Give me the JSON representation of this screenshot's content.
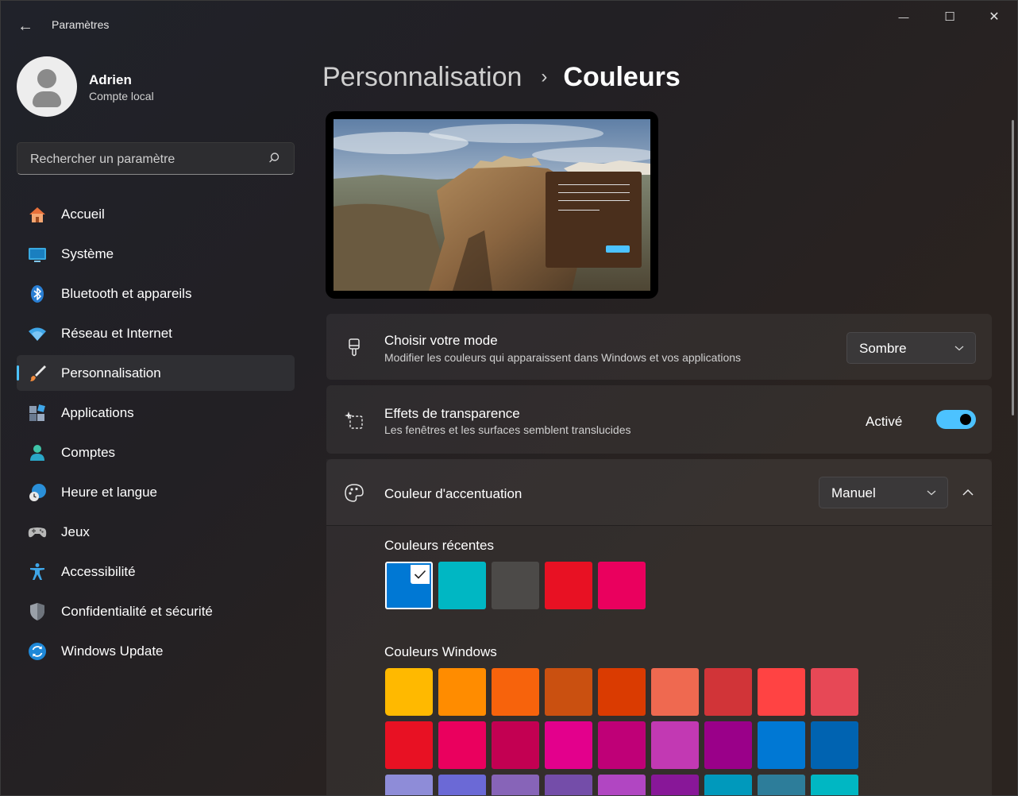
{
  "window": {
    "title": "Paramètres",
    "back_glyph": "←",
    "minimize_glyph": "—",
    "maximize_glyph": "☐",
    "close_glyph": "✕"
  },
  "profile": {
    "name": "Adrien",
    "account_type": "Compte local"
  },
  "search": {
    "placeholder": "Rechercher un paramètre"
  },
  "sidebar": {
    "items": [
      {
        "label": "Accueil",
        "icon": "home-icon"
      },
      {
        "label": "Système",
        "icon": "system-icon"
      },
      {
        "label": "Bluetooth et appareils",
        "icon": "bluetooth-icon"
      },
      {
        "label": "Réseau et Internet",
        "icon": "wifi-icon"
      },
      {
        "label": "Personnalisation",
        "icon": "brush-icon",
        "active": true
      },
      {
        "label": "Applications",
        "icon": "apps-icon"
      },
      {
        "label": "Comptes",
        "icon": "person-icon"
      },
      {
        "label": "Heure et langue",
        "icon": "clock-globe-icon"
      },
      {
        "label": "Jeux",
        "icon": "gamepad-icon"
      },
      {
        "label": "Accessibilité",
        "icon": "accessibility-icon"
      },
      {
        "label": "Confidentialité et sécurité",
        "icon": "shield-icon"
      },
      {
        "label": "Windows Update",
        "icon": "update-icon"
      }
    ]
  },
  "breadcrumb": {
    "parent": "Personnalisation",
    "separator": "›",
    "current": "Couleurs"
  },
  "mode_card": {
    "title": "Choisir votre mode",
    "subtitle": "Modifier les couleurs qui apparaissent dans Windows et vos applications",
    "value": "Sombre"
  },
  "transparency_card": {
    "title": "Effets de transparence",
    "subtitle": "Les fenêtres et les surfaces semblent translucides",
    "state_label": "Activé",
    "on": true
  },
  "accent_card": {
    "title": "Couleur d'accentuation",
    "value": "Manuel",
    "expanded": true
  },
  "recent_colors": {
    "label": "Couleurs récentes",
    "selected_index": 0,
    "colors": [
      "#0078d4",
      "#00b7c3",
      "#4c4a48",
      "#e81123",
      "#ea005e"
    ]
  },
  "windows_colors": {
    "label": "Couleurs Windows",
    "rows": [
      [
        "#ffb900",
        "#ff8c00",
        "#f7630c",
        "#ca5010",
        "#da3b01",
        "#ef6950",
        "#d13438",
        "#ff4343",
        "#e74856"
      ],
      [
        "#e81123",
        "#ea005e",
        "#c30052",
        "#e3008c",
        "#bf0077",
        "#c239b3",
        "#9a0089",
        "#0078d4",
        "#0063b1"
      ],
      [
        "#8e8cd8",
        "#6b69d6",
        "#8764b8",
        "#744da9",
        "#b146c2",
        "#881798",
        "#0099bc",
        "#2d7d9a",
        "#00b7c3"
      ]
    ]
  },
  "colors": {
    "accent": "#4cc2ff"
  }
}
